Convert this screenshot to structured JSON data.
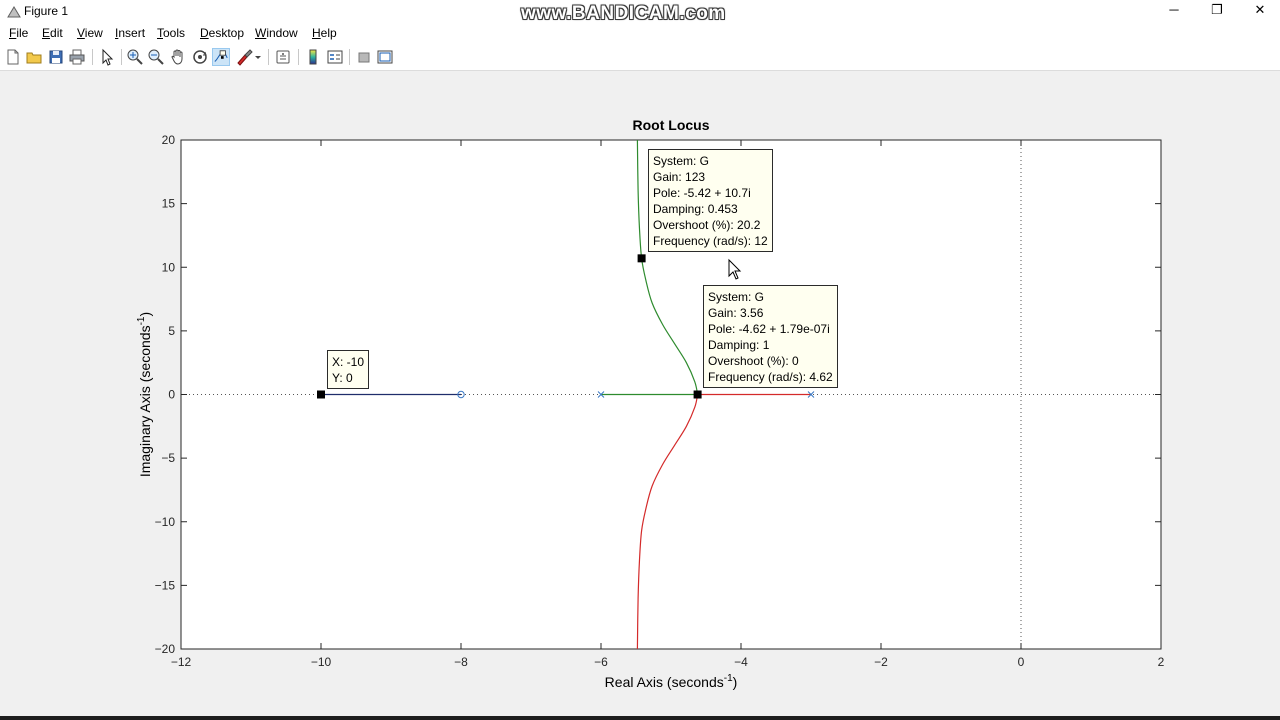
{
  "window": {
    "title": "Figure 1",
    "watermark": "www.BANDICAM.com",
    "controls": {
      "minimize": "─",
      "restore": "❐",
      "close": "✕"
    }
  },
  "menu": {
    "items": [
      {
        "label": "File",
        "ul": "F",
        "rest": "ile"
      },
      {
        "label": "Edit",
        "ul": "E",
        "rest": "dit"
      },
      {
        "label": "View",
        "ul": "V",
        "rest": "iew"
      },
      {
        "label": "Insert",
        "ul": "I",
        "rest": "nsert"
      },
      {
        "label": "Tools",
        "ul": "T",
        "rest": "ools"
      },
      {
        "label": "Desktop",
        "ul": "D",
        "rest": "esktop"
      },
      {
        "label": "Window",
        "ul": "W",
        "rest": "indow"
      },
      {
        "label": "Help",
        "ul": "H",
        "rest": "elp"
      }
    ]
  },
  "toolbar": {
    "icons": [
      "new-figure-icon",
      "open-file-icon",
      "save-icon",
      "print-icon",
      "edit-plot-icon",
      "zoom-in-icon",
      "zoom-out-icon",
      "pan-icon",
      "rotate-3d-icon",
      "data-cursor-icon",
      "brush-icon",
      "link-plot-icon",
      "insert-colorbar-icon",
      "insert-legend-icon",
      "hide-plot-tools-icon",
      "show-plot-tools-icon"
    ],
    "active": "data-cursor-icon"
  },
  "chart_data": {
    "type": "line",
    "title": "Root Locus",
    "xlabel": "Real Axis (seconds",
    "xlabel_sup": "-1",
    "xlabel_end": ")",
    "ylabel": "Imaginary Axis (seconds",
    "ylabel_sup": "-1",
    "ylabel_end": ")",
    "xlim": [
      -12,
      2
    ],
    "ylim": [
      -20,
      20
    ],
    "xticks": [
      -12,
      -10,
      -8,
      -6,
      -4,
      -2,
      0,
      2
    ],
    "yticks": [
      -20,
      -15,
      -10,
      -5,
      0,
      5,
      10,
      15,
      20
    ],
    "grid": false,
    "series": [
      {
        "color": "#1f2d6b",
        "points": [
          [
            -10,
            0
          ],
          [
            -8,
            0
          ]
        ]
      },
      {
        "color": "#2e8b2e",
        "points": [
          [
            -6,
            0
          ],
          [
            -4.62,
            0
          ],
          [
            -4.66,
            1.0
          ],
          [
            -4.78,
            2.5
          ],
          [
            -4.95,
            4.0
          ],
          [
            -5.12,
            5.5
          ],
          [
            -5.27,
            7.2
          ],
          [
            -5.36,
            9.0
          ],
          [
            -5.42,
            10.7
          ],
          [
            -5.45,
            13.0
          ],
          [
            -5.47,
            16.0
          ],
          [
            -5.48,
            20.0
          ]
        ]
      },
      {
        "color": "#d42a2a",
        "points": [
          [
            -3,
            0
          ],
          [
            -4.62,
            0
          ],
          [
            -4.66,
            -1.0
          ],
          [
            -4.78,
            -2.5
          ],
          [
            -4.95,
            -4.0
          ],
          [
            -5.12,
            -5.5
          ],
          [
            -5.27,
            -7.2
          ],
          [
            -5.36,
            -9.0
          ],
          [
            -5.42,
            -10.7
          ],
          [
            -5.45,
            -13.0
          ],
          [
            -5.47,
            -16.0
          ],
          [
            -5.48,
            -20.0
          ]
        ]
      }
    ],
    "poles": [
      [
        -6,
        0
      ],
      [
        -3,
        0
      ]
    ],
    "zeros": [
      [
        -8,
        0
      ]
    ],
    "pole_color": "#3a78c4",
    "datatips": [
      {
        "point": [
          -5.42,
          10.7
        ],
        "lines": [
          "System: G",
          "Gain: 123",
          "Pole: -5.42 + 10.7i",
          "Damping: 0.453",
          "Overshoot (%): 20.2",
          "Frequency (rad/s): 12"
        ]
      },
      {
        "point": [
          -4.62,
          0
        ],
        "lines": [
          "System: G",
          "Gain: 3.56",
          "Pole: -4.62 + 1.79e-07i",
          "Damping: 1",
          "Overshoot (%): 0",
          "Frequency (rad/s): 4.62"
        ]
      },
      {
        "point": [
          -10,
          0
        ],
        "lines": [
          "X: -10",
          "Y: 0"
        ]
      }
    ]
  }
}
